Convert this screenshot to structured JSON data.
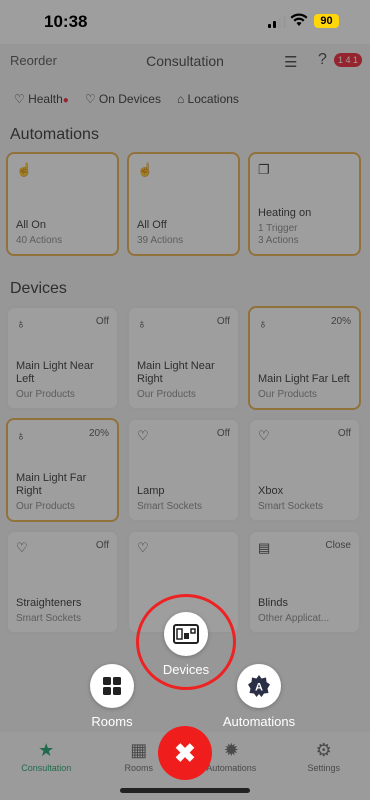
{
  "status_bar": {
    "time": "10:38",
    "battery": "90"
  },
  "topbar": {
    "left": "Reorder",
    "title": "Consultation",
    "badge": "1 4 1"
  },
  "filters": [
    {
      "label": "Health"
    },
    {
      "label": "On Devices"
    },
    {
      "label": "Locations"
    }
  ],
  "sections": {
    "automations": "Automations",
    "devices": "Devices"
  },
  "automations": [
    {
      "name": "All On",
      "sub": "40 Actions",
      "icon": "hand-tap-icon"
    },
    {
      "name": "All Off",
      "sub": "39 Actions",
      "icon": "hand-tap-icon"
    },
    {
      "name": "Heating on",
      "sub1": "1 Trigger",
      "sub2": "3 Actions",
      "icon": "copy-icon"
    }
  ],
  "devices": [
    {
      "name": "Main Light Near Left",
      "sub": "Our Products",
      "state": "Off",
      "active": false,
      "icon": "bulb-icon"
    },
    {
      "name": "Main Light Near Right",
      "sub": "Our Products",
      "state": "Off",
      "active": false,
      "icon": "bulb-icon"
    },
    {
      "name": "Main Light Far Left",
      "sub": "Our Products",
      "state": "20%",
      "active": true,
      "icon": "bulb-icon"
    },
    {
      "name": "Main Light Far Right",
      "sub": "Our Products",
      "state": "20%",
      "active": true,
      "icon": "bulb-icon"
    },
    {
      "name": "Lamp",
      "sub": "Smart Sockets",
      "state": "Off",
      "active": false,
      "icon": "plug-icon"
    },
    {
      "name": "Xbox",
      "sub": "Smart Sockets",
      "state": "Off",
      "active": false,
      "icon": "plug-icon"
    },
    {
      "name": "Straighteners",
      "sub": "Smart Sockets",
      "state": "Off",
      "active": false,
      "icon": "plug-icon"
    },
    {
      "name": "Blinds",
      "sub": "Other Applicat...",
      "state": "Close",
      "active": false,
      "icon": "blinds-icon"
    }
  ],
  "tabs": [
    {
      "label": "Consultation",
      "active": true
    },
    {
      "label": "Rooms",
      "active": false
    },
    {
      "label": "Automations",
      "active": false
    },
    {
      "label": "Settings",
      "active": false
    }
  ],
  "fab_menu": {
    "devices_label": "Devices",
    "rooms_label": "Rooms",
    "automations_label": "Automations"
  }
}
